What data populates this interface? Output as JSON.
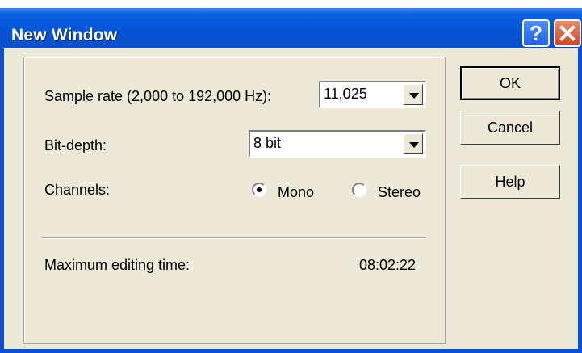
{
  "window": {
    "title": "New Window"
  },
  "titlebar": {
    "help_icon": "question-mark-icon",
    "help_glyph": "?",
    "close_icon": "close-icon"
  },
  "form": {
    "sample_rate": {
      "label": "Sample rate (2,000 to 192,000 Hz):",
      "value": "11,025"
    },
    "bit_depth": {
      "label": "Bit-depth:",
      "value": "8 bit"
    },
    "channels": {
      "label": "Channels:",
      "options": [
        {
          "label": "Mono",
          "selected": true
        },
        {
          "label": "Stereo",
          "selected": false
        }
      ]
    },
    "max_editing_time": {
      "label": "Maximum editing time:",
      "value": "08:02:22"
    }
  },
  "buttons": {
    "ok": "OK",
    "cancel": "Cancel",
    "help": "Help"
  },
  "colors": {
    "titlebar": "#0553d6",
    "dialog_bg": "#ece9d8",
    "close": "#d2452a"
  }
}
